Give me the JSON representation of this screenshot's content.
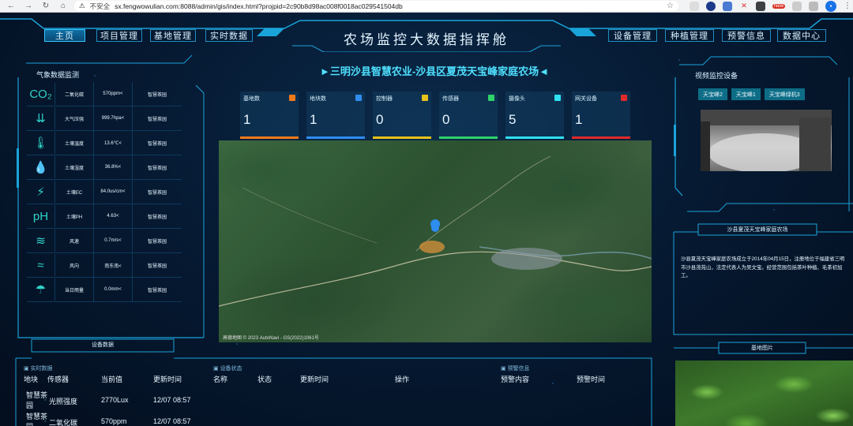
{
  "browser": {
    "insecure_label": "不安全",
    "url": "sx.fengwowulian.com:8088/admin/gis/index.html?projpid=2c90b8d98ac008f0018ac029541504db",
    "new_badge": "New"
  },
  "header": {
    "title": "农场监控大数据指挥舱",
    "nav_left": [
      "主页",
      "项目管理",
      "基地管理",
      "实时数据"
    ],
    "nav_right": [
      "设备管理",
      "种植管理",
      "预警信息",
      "数据中心"
    ]
  },
  "weather": {
    "title": "气象数据监测",
    "rows": [
      {
        "icon": "co2-icon",
        "name": "二氧化碳",
        "value": "570ppm<",
        "location": "智慧茶园"
      },
      {
        "icon": "pressure-icon",
        "name": "大气压强",
        "value": "999.7hpa<",
        "location": "智慧茶园"
      },
      {
        "icon": "thermometer-icon",
        "name": "土壤温度",
        "value": "13.6℃<",
        "location": "智慧茶园"
      },
      {
        "icon": "humidity-icon",
        "name": "土壤湿度",
        "value": "36.8%<",
        "location": "智慧茶园"
      },
      {
        "icon": "ec-icon",
        "name": "土壤EC",
        "value": "84.0us/cm<",
        "location": "智慧茶园"
      },
      {
        "icon": "ph-icon",
        "name": "土壤PH",
        "value": "4.63<",
        "location": "智慧茶园"
      },
      {
        "icon": "wind-speed-icon",
        "name": "风速",
        "value": "0.7m/s<",
        "location": "智慧茶园"
      },
      {
        "icon": "wind-direction-icon",
        "name": "风向",
        "value": "南东南<",
        "location": "智慧茶园"
      },
      {
        "icon": "rainfall-icon",
        "name": "当日雨量",
        "value": "0.0mm<",
        "location": "智慧茶园"
      }
    ]
  },
  "farm_name": "►三明沙县智慧农业-沙县区夏茂天宝峰家庭农场◄",
  "stats": [
    {
      "label": "基地数",
      "value": "1",
      "color": "#f07a1a"
    },
    {
      "label": "地块数",
      "value": "1",
      "color": "#2f8df0"
    },
    {
      "label": "控制器",
      "value": "0",
      "color": "#e8c21a"
    },
    {
      "label": "传感器",
      "value": "0",
      "color": "#2fd36a"
    },
    {
      "label": "摄像头",
      "value": "5",
      "color": "#2fe0f0"
    },
    {
      "label": "网关设备",
      "value": "1",
      "color": "#e02a2a"
    }
  ],
  "map": {
    "attribution": "高德地图 © 2023 AutoNavi - GS(2022)1061号"
  },
  "video": {
    "title": "视频监控设备",
    "tabs": [
      "天宝峰2",
      "天宝峰1",
      "天宝峰绿机3"
    ]
  },
  "about": {
    "title": "沙县夏茂天宝峰家庭农场",
    "text": "沙县夏茂天宝峰家庭农场成立于2014年04月15日，注册地位于福建省三明市沙县茂苑山，法定代表人为吴文宝。经营范围包括茶叶种植、毛茶初加工。"
  },
  "plot_image": {
    "title": "基地图片"
  },
  "devices": {
    "title": "设备数据",
    "realtime_section": "实时数据",
    "status_section": "设备状态",
    "alert_section": "预警信息",
    "realtime_headers": [
      "地块",
      "传感器",
      "当前值",
      "更新时间"
    ],
    "status_headers": [
      "名称",
      "状态",
      "更新时间",
      "操作"
    ],
    "alert_headers": [
      "预警内容",
      "预警时间"
    ],
    "rows": [
      {
        "plot": "智慧茶园",
        "sensor": "光照强度",
        "value": "2770Lux",
        "time": "12/07 08:57"
      },
      {
        "plot": "智慧茶园",
        "sensor": "二氧化碳",
        "value": "570ppm",
        "time": "12/07 08:57"
      }
    ]
  }
}
